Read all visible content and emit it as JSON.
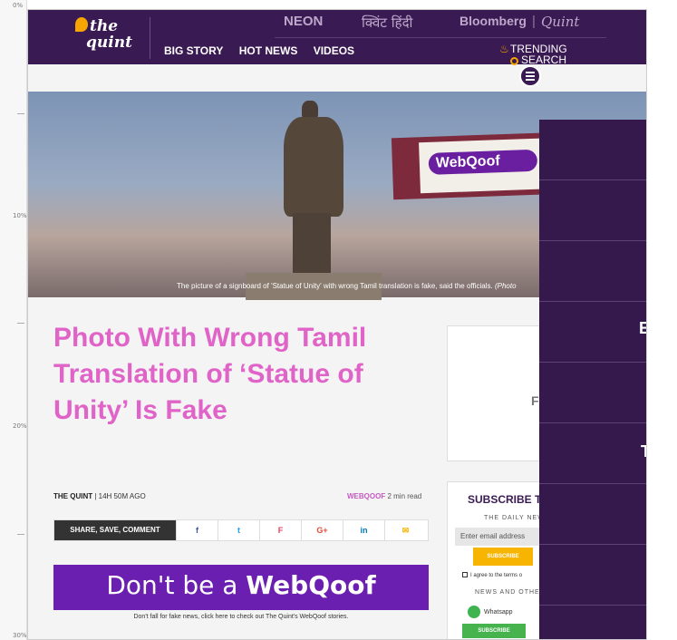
{
  "ruler": {
    "marks": [
      "0%",
      "10%",
      "20%",
      "30%"
    ]
  },
  "header": {
    "logo_line1": "the",
    "logo_line2": "quint",
    "brands": [
      "NEON",
      "क्विंट हिंदी",
      "Bloomberg",
      "Quint"
    ],
    "nav": [
      "BIG STORY",
      "HOT NEWS",
      "VIDEOS"
    ],
    "trending_line1": "TRENDING",
    "trending_line2": "SEARCH"
  },
  "hero": {
    "sign_text": "WebQoof",
    "caption": "The picture of a signboard of 'Statue of Unity' with wrong Tamil translation is fake, said the officials.",
    "caption_tail": "(Photo"
  },
  "article": {
    "title": "Photo With Wrong Tamil Translation of ‘Statue of Unity’ Is Fake",
    "author": "THE QUINT",
    "time": "| 14H 50M AGO",
    "category": "WEBQOOF",
    "read_time": "2 min read",
    "share_label": "SHARE, SAVE, COMMENT",
    "share_icons": [
      "f",
      "t",
      "F",
      "G+",
      "in",
      "✉"
    ]
  },
  "banner": {
    "text_prefix": "Don't be a ",
    "text_brand": "WebQoof",
    "caption": "Don't fall for fake news, click here to check out The Quint's WebQoof stories."
  },
  "sidebar": {
    "box_letter": "F",
    "subscribe_title": "SUBSCRIBE TO",
    "daily_news": "THE DAILY NEW",
    "email_placeholder": "Enter email address",
    "subscribe_btn": "SUBSCRIBE",
    "agree": "I agree to the terms o",
    "news_and_other": "NEWS AND OTHE",
    "whatsapp": "Whatsapp",
    "subscribe_btn2": "SUBSCRIBE"
  },
  "overlay": {
    "letters": [
      "E",
      "T"
    ]
  },
  "colors": {
    "brand": "#3a1a52",
    "title": "#e064c8",
    "accent": "#f7b400",
    "webqoof": "#6b1fb0"
  }
}
